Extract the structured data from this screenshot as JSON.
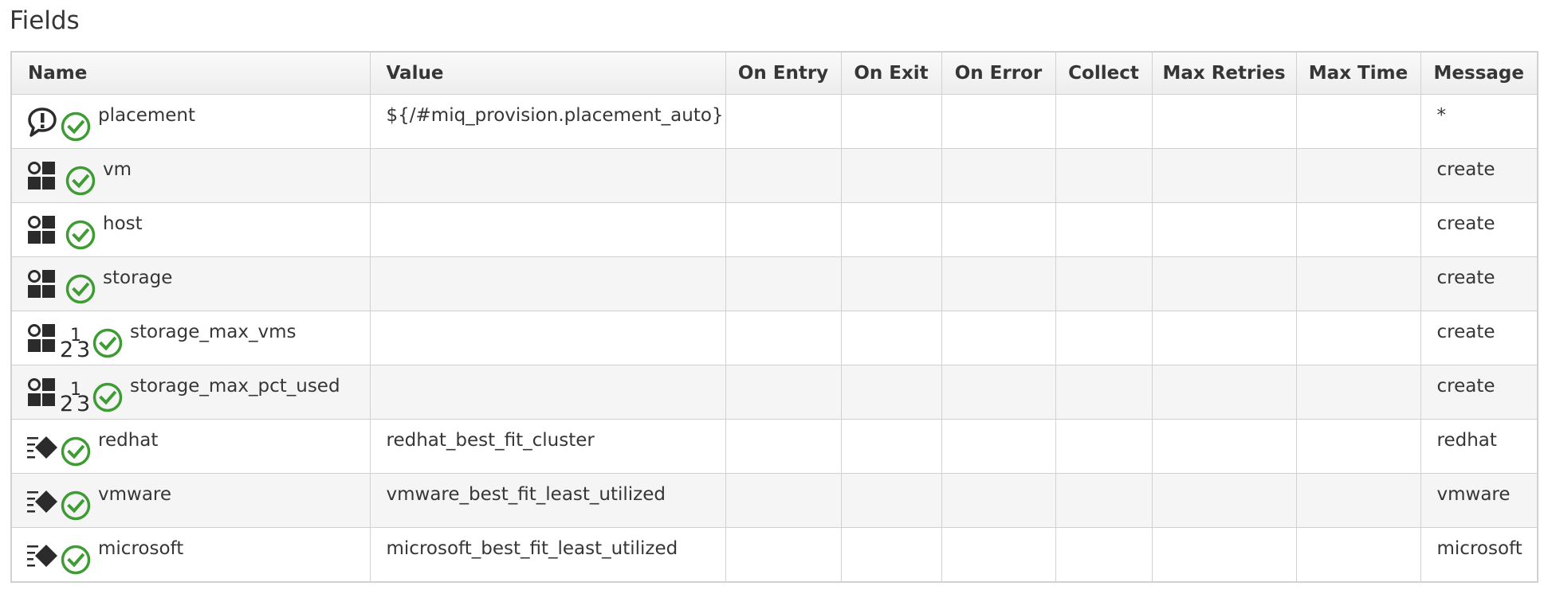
{
  "title": "Fields",
  "columns": [
    "Name",
    "Value",
    "On Entry",
    "On Exit",
    "On Error",
    "Collect",
    "Max Retries",
    "Max Time",
    "Message"
  ],
  "rows": [
    {
      "type_icon": "comment-exclamation-icon",
      "status_icon": "check-circle-icon",
      "name": "placement",
      "value": "${/#miq_provision.placement_auto}",
      "on_entry": "",
      "on_exit": "",
      "on_error": "",
      "collect": "",
      "max_retries": "",
      "max_time": "",
      "message": "*"
    },
    {
      "type_icon": "data-grid-icon",
      "status_icon": "check-circle-icon",
      "name": "vm",
      "value": "",
      "on_entry": "",
      "on_exit": "",
      "on_error": "",
      "collect": "",
      "max_retries": "",
      "max_time": "",
      "message": "create"
    },
    {
      "type_icon": "data-grid-icon",
      "status_icon": "check-circle-icon",
      "name": "host",
      "value": "",
      "on_entry": "",
      "on_exit": "",
      "on_error": "",
      "collect": "",
      "max_retries": "",
      "max_time": "",
      "message": "create"
    },
    {
      "type_icon": "data-grid-icon",
      "status_icon": "check-circle-icon",
      "name": "storage",
      "value": "",
      "on_entry": "",
      "on_exit": "",
      "on_error": "",
      "collect": "",
      "max_retries": "",
      "max_time": "",
      "message": "create"
    },
    {
      "type_icon": "data-grid-icon",
      "extra_icon": "numeric-123-icon",
      "status_icon": "check-circle-icon",
      "name": "storage_max_vms",
      "value": "",
      "on_entry": "",
      "on_exit": "",
      "on_error": "",
      "collect": "",
      "max_retries": "",
      "max_time": "",
      "message": "create"
    },
    {
      "type_icon": "data-grid-icon",
      "extra_icon": "numeric-123-icon",
      "status_icon": "check-circle-icon",
      "name": "storage_max_pct_used",
      "value": "",
      "on_entry": "",
      "on_exit": "",
      "on_error": "",
      "collect": "",
      "max_retries": "",
      "max_time": "",
      "message": "create"
    },
    {
      "type_icon": "relationship-diamond-icon",
      "status_icon": "check-circle-icon",
      "name": "redhat",
      "value": "redhat_best_fit_cluster",
      "on_entry": "",
      "on_exit": "",
      "on_error": "",
      "collect": "",
      "max_retries": "",
      "max_time": "",
      "message": "redhat"
    },
    {
      "type_icon": "relationship-diamond-icon",
      "status_icon": "check-circle-icon",
      "name": "vmware",
      "value": "vmware_best_fit_least_utilized",
      "on_entry": "",
      "on_exit": "",
      "on_error": "",
      "collect": "",
      "max_retries": "",
      "max_time": "",
      "message": "vmware"
    },
    {
      "type_icon": "relationship-diamond-icon",
      "status_icon": "check-circle-icon",
      "name": "microsoft",
      "value": "microsoft_best_fit_least_utilized",
      "on_entry": "",
      "on_exit": "",
      "on_error": "",
      "collect": "",
      "max_retries": "",
      "max_time": "",
      "message": "microsoft"
    }
  ],
  "colors": {
    "text": "#363636",
    "border": "#d1d1d1",
    "stripe": "#f5f5f5",
    "status_green": "#3f9c35",
    "icon_dark": "#2b2b2b"
  }
}
